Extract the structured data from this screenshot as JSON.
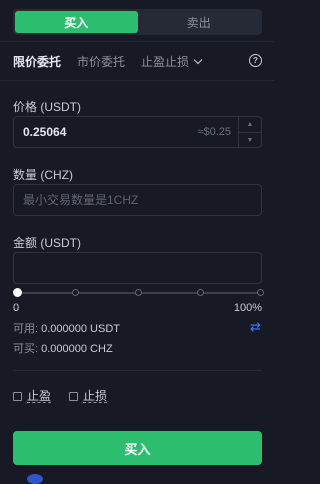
{
  "side_toggle": {
    "buy": "买入",
    "sell": "卖出"
  },
  "order_tabs": {
    "limit": "限价委托",
    "market": "市价委托",
    "tp_sl": "止盈止损"
  },
  "help_glyph": "?",
  "price": {
    "label": "价格 (USDT)",
    "value": "0.25064",
    "approx": "≈$0.25"
  },
  "quantity": {
    "label": "数量 (CHZ)",
    "placeholder": "最小交易数量是1CHZ"
  },
  "amount": {
    "label": "金额 (USDT)",
    "placeholder": ""
  },
  "slider": {
    "min_label": "0",
    "max_label": "100%",
    "value_percent": 0
  },
  "available": {
    "label": "可用:",
    "value": "0.000000 USDT"
  },
  "can_buy": {
    "label": "可买:",
    "value": "0.000000 CHZ"
  },
  "options": {
    "take_profit": "止盈",
    "stop_loss": "止损"
  },
  "submit": {
    "label": "买入"
  },
  "colors": {
    "buy": "#2dbd6e",
    "accent": "#3d7dff",
    "background": "#171a24"
  },
  "icons": {
    "help": "help-circle-icon",
    "swap": "swap-arrows-icon",
    "dropdown": "chevron-down-icon"
  }
}
